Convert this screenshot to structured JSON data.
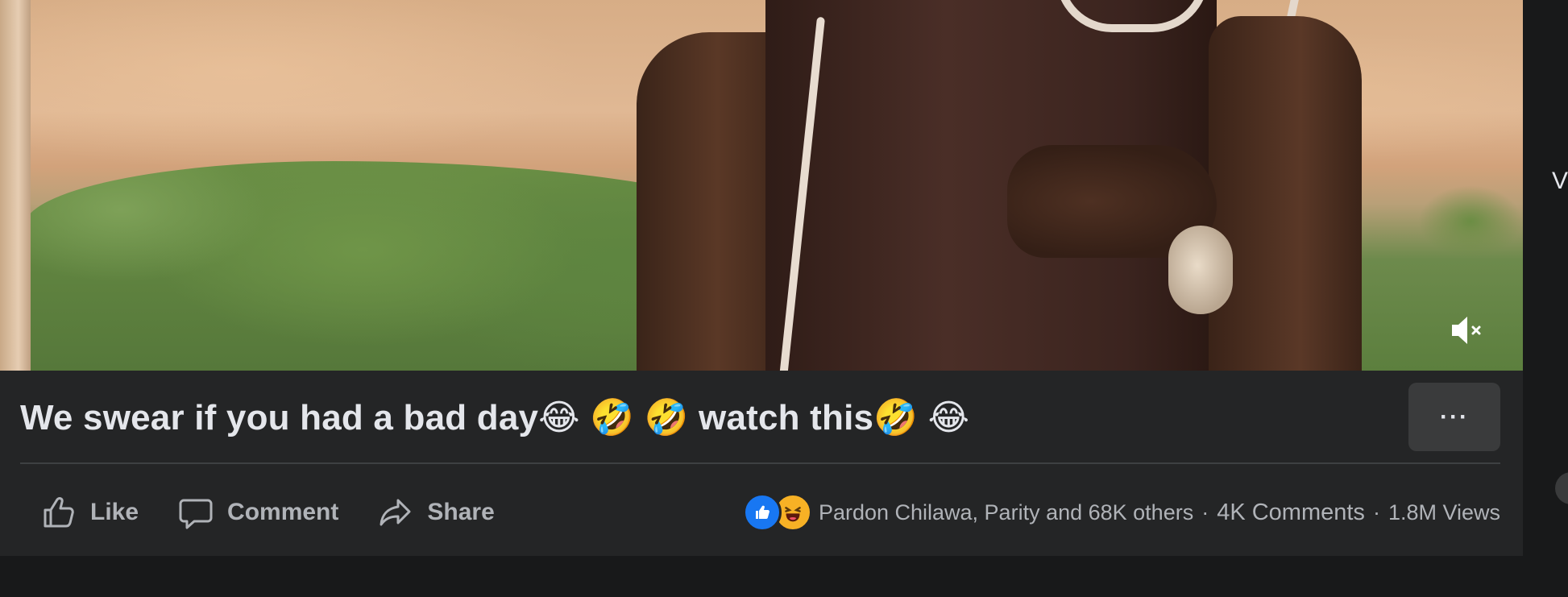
{
  "post": {
    "title": "We swear if you had a bad day😂 🤣 🤣  watch this🤣 😂",
    "more_label": "···",
    "actions": {
      "like": "Like",
      "comment": "Comment",
      "share": "Share"
    },
    "stats": {
      "reactors": "Pardon Chilawa, Parity and 68K others",
      "comments": "4K Comments",
      "views": "1.8M Views",
      "separator": "·"
    },
    "reactions": [
      "like-icon",
      "haha-icon"
    ],
    "video": {
      "muted": true
    }
  },
  "side_panel": {
    "partial_text": "V"
  },
  "colors": {
    "page_bg": "#18191a",
    "card_bg": "#242526",
    "text_primary": "#e4e6eb",
    "text_secondary": "#b0b3b8",
    "like_blue": "#1877f2",
    "haha_yellow": "#f7b125"
  }
}
